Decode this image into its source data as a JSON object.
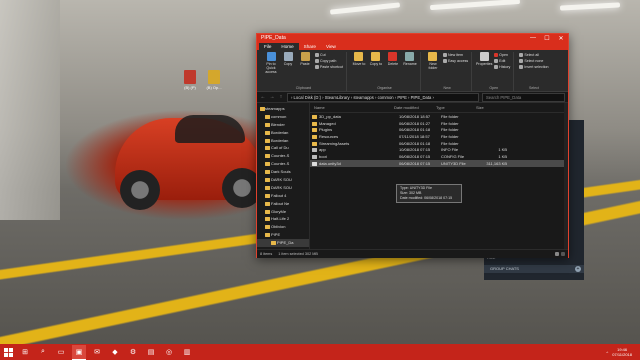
{
  "window": {
    "title": "PIPE_Data",
    "minimize": "—",
    "maximize": "☐",
    "close": "✕"
  },
  "menu_tabs": [
    "File",
    "Home",
    "Share",
    "View"
  ],
  "ribbon": {
    "clipboard": {
      "pin": "Pin to Quick access",
      "copy": "Copy",
      "paste": "Paste",
      "cut": "Cut",
      "copy_path": "Copy path",
      "paste_shortcut": "Paste shortcut",
      "group": "Clipboard"
    },
    "organise": {
      "move_to": "Move to",
      "copy_to": "Copy to",
      "delete": "Delete",
      "rename": "Rename",
      "group": "Organise"
    },
    "new": {
      "new_folder": "New folder",
      "new_item": "New item",
      "easy_access": "Easy access",
      "group": "New"
    },
    "open": {
      "properties": "Properties",
      "open": "Open",
      "edit": "Edit",
      "history": "History",
      "group": "Open"
    },
    "select": {
      "select_all": "Select all",
      "select_none": "Select none",
      "invert": "Invert selection",
      "group": "Select"
    }
  },
  "address": {
    "back": "←",
    "forward": "→",
    "up": "↑",
    "path": "›  Local Disk (D:)  ›  SteamLibrary  ›  steamapps  ›  common  ›  PIPE  ›  PIPE_Data  ›",
    "search_placeholder": "Search PIPE_Data"
  },
  "nav_items": [
    {
      "label": "steamapps",
      "kind": "root"
    },
    {
      "label": "common",
      "kind": "normal"
    },
    {
      "label": "Blender",
      "kind": "normal"
    },
    {
      "label": "Borderlan",
      "kind": "normal"
    },
    {
      "label": "Borderlan",
      "kind": "normal"
    },
    {
      "label": "Call of Du",
      "kind": "normal"
    },
    {
      "label": "Counter-S",
      "kind": "normal"
    },
    {
      "label": "Counter-S",
      "kind": "normal"
    },
    {
      "label": "Dark Souls",
      "kind": "normal"
    },
    {
      "label": "DARK SOU",
      "kind": "normal"
    },
    {
      "label": "DARK SOU",
      "kind": "normal"
    },
    {
      "label": "Fallout 4",
      "kind": "normal"
    },
    {
      "label": "Fallout Ne",
      "kind": "normal"
    },
    {
      "label": "GloryMe",
      "kind": "normal"
    },
    {
      "label": "Half-Life 2",
      "kind": "normal"
    },
    {
      "label": "Oblivion",
      "kind": "normal"
    },
    {
      "label": "PIPE",
      "kind": "normal"
    },
    {
      "label": "PIPE_Da",
      "kind": "sel"
    }
  ],
  "columns": {
    "name": "Name",
    "date": "Date modified",
    "type": "Type",
    "size": "Size"
  },
  "files": [
    {
      "name": "3D_pp_data",
      "date": "10/08/2018 18:57",
      "type": "File folder",
      "size": "",
      "kind": "folder"
    },
    {
      "name": "Managed",
      "date": "06/08/2018 01:27",
      "type": "File folder",
      "size": "",
      "kind": "folder"
    },
    {
      "name": "Plugins",
      "date": "06/08/2018 01:18",
      "type": "File folder",
      "size": "",
      "kind": "folder"
    },
    {
      "name": "Resources",
      "date": "07/11/2018 18:57",
      "type": "File folder",
      "size": "",
      "kind": "folder"
    },
    {
      "name": "StreamingAssets",
      "date": "06/08/2018 01:18",
      "type": "File folder",
      "size": "",
      "kind": "folder"
    },
    {
      "name": "app",
      "date": "10/08/2018 07:15",
      "type": "INFO File",
      "size": "1 KB",
      "kind": "file"
    },
    {
      "name": "boot",
      "date": "06/08/2018 07:15",
      "type": "CONFIG File",
      "size": "1 KB",
      "kind": "file"
    },
    {
      "name": "data.unity3d",
      "date": "06/08/2018 07:15",
      "type": "UNITY3D File",
      "size": "311,163 KB",
      "kind": "unity",
      "selected": true
    }
  ],
  "tooltip": {
    "type": "Type: UNITY3D File",
    "size": "Size: 302 MB",
    "modified": "Date modified: 06/08/2018 07:15"
  },
  "status": {
    "count": "8 items",
    "selected": "1 item selected  302 MB"
  },
  "desktop_icons": [
    {
      "label": "(B) (P)",
      "color": "#c0392b"
    },
    {
      "label": "(B) Op...",
      "color": "#d4a72c"
    }
  ],
  "steam": {
    "user": "Rust",
    "group_chats": "GROUP CHATS",
    "plus": "+"
  },
  "taskbar": {
    "icons": [
      "⊞",
      "⌕",
      "▭",
      "▣",
      "✉",
      "◆",
      "⚙",
      "▤",
      "◎",
      "▥"
    ],
    "tray_arrow": "^",
    "time": "19:46",
    "date": "07/11/2018"
  },
  "colors": {
    "accent": "#d92e1c",
    "taskbar": "#c4241a",
    "folder": "#e7b84a"
  }
}
